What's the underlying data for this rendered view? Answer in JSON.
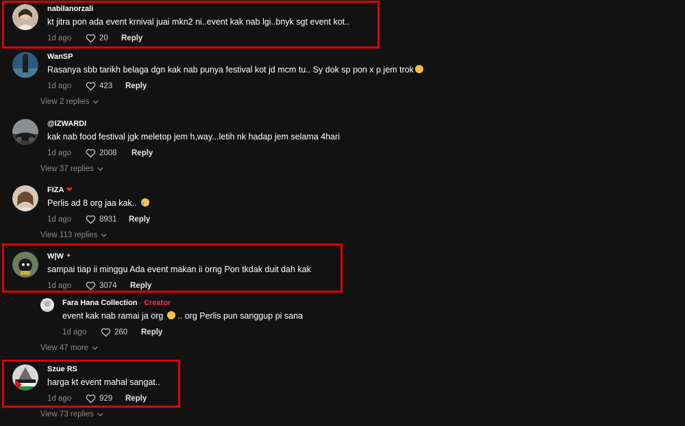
{
  "comments": [
    {
      "username": "nabilanorzali",
      "text": "kt jitra pon ada event krnival juai mkn2 ni..event kak nab lgi..bnyk sgt event kot..",
      "date": "1d ago",
      "likes": "20",
      "reply": "Reply"
    },
    {
      "username": "WanSP",
      "text": "Rasanya sbb tarikh belaga dgn kak nab punya festival kot jd mcm tu.. Sy dok sp pon x p jem trok",
      "date": "1d ago",
      "likes": "423",
      "reply": "Reply",
      "view_replies": "View 2 replies"
    },
    {
      "username": "@IZWARDI",
      "text": "kak nab food festival jgk meletop jem h,way...letih nk hadap jem selama 4hari",
      "date": "1d ago",
      "likes": "2008",
      "reply": "Reply",
      "view_replies": "View 37 replies"
    },
    {
      "username": "FIZA",
      "text": "Perlis ad 8 org jaa kak..",
      "date": "1d ago",
      "likes": "8931",
      "reply": "Reply",
      "view_replies": "View 113 replies"
    },
    {
      "username": "W|W",
      "text": "sampai tiap ii minggu Ada event makan ii orng Pon tkdak duit dah kak",
      "date": "1d ago",
      "likes": "3074",
      "reply": "Reply"
    },
    {
      "username": "Szue RS",
      "text": "harga kt event mahal sangat..",
      "date": "1d ago",
      "likes": "929",
      "reply": "Reply",
      "view_replies": "View 73 replies"
    }
  ],
  "creator_reply": {
    "username": "Fara Hana Collection",
    "separator": "·",
    "badge": "Creator",
    "text": "event kak nab ramai ja org",
    "text_after": ".. org Perlis pun sanggup pi sana",
    "date": "1d ago",
    "likes": "260",
    "reply": "Reply",
    "view_more": "View 47 more"
  },
  "colors": {
    "highlight": "#e00000",
    "creator_badge": "#fe2c55",
    "background": "#121212"
  }
}
